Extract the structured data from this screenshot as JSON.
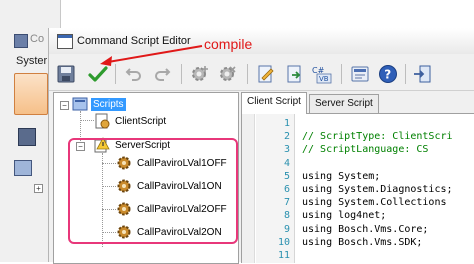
{
  "background_window": {
    "title": "Co",
    "menu_label": "Syster"
  },
  "window": {
    "title": "Command Script Editor"
  },
  "annotation": {
    "label": "compile",
    "color": "#e01818"
  },
  "toolbar": {
    "buttons": [
      {
        "name": "save-icon"
      },
      {
        "name": "compile-checkmark-icon"
      },
      {
        "name": "undo-icon"
      },
      {
        "name": "redo-icon"
      },
      {
        "name": "gear-add-icon"
      },
      {
        "name": "gear-remove-icon"
      },
      {
        "name": "edit-document-icon"
      },
      {
        "name": "import-document-icon"
      },
      {
        "name": "language-cs-vb-icon",
        "label_top": "C#",
        "label_bottom": "VB"
      },
      {
        "name": "script-settings-icon"
      },
      {
        "name": "help-icon",
        "label": "?"
      },
      {
        "name": "exit-icon"
      }
    ]
  },
  "tree": {
    "root": {
      "label": "Scripts",
      "expander": "−"
    },
    "client": {
      "label": "ClientScript"
    },
    "server": {
      "label": "ServerScript",
      "expander": "−",
      "children": [
        {
          "label": "CallPaviroLVal1OFF"
        },
        {
          "label": "CallPaviroLVal1ON"
        },
        {
          "label": "CallPaviroLVal2OFF"
        },
        {
          "label": "CallPaviroLVal2ON"
        }
      ]
    }
  },
  "tabs": [
    {
      "label": "Client Script",
      "active": true
    },
    {
      "label": "Server Script",
      "active": false
    }
  ],
  "code": {
    "lines": [
      {
        "n": "1",
        "text": "",
        "kind": "plain"
      },
      {
        "n": "2",
        "text": "// ScriptType: ClientScri",
        "kind": "comment"
      },
      {
        "n": "3",
        "text": "// ScriptLanguage: CS",
        "kind": "comment"
      },
      {
        "n": "4",
        "text": "",
        "kind": "plain"
      },
      {
        "n": "5",
        "text": "using System;",
        "kind": "plain"
      },
      {
        "n": "6",
        "text": "using System.Diagnostics;",
        "kind": "plain"
      },
      {
        "n": "7",
        "text": "using System.Collections",
        "kind": "plain"
      },
      {
        "n": "8",
        "text": "using log4net;",
        "kind": "plain"
      },
      {
        "n": "9",
        "text": "using Bosch.Vms.Core;",
        "kind": "plain"
      },
      {
        "n": "10",
        "text": "using Bosch.Vms.SDK;",
        "kind": "plain"
      },
      {
        "n": "11",
        "text": "",
        "kind": "plain"
      }
    ]
  },
  "colors": {
    "highlight_box": "#e8377a",
    "selection": "#3399ff",
    "comment": "#008000",
    "line_number": "#2b91af"
  }
}
